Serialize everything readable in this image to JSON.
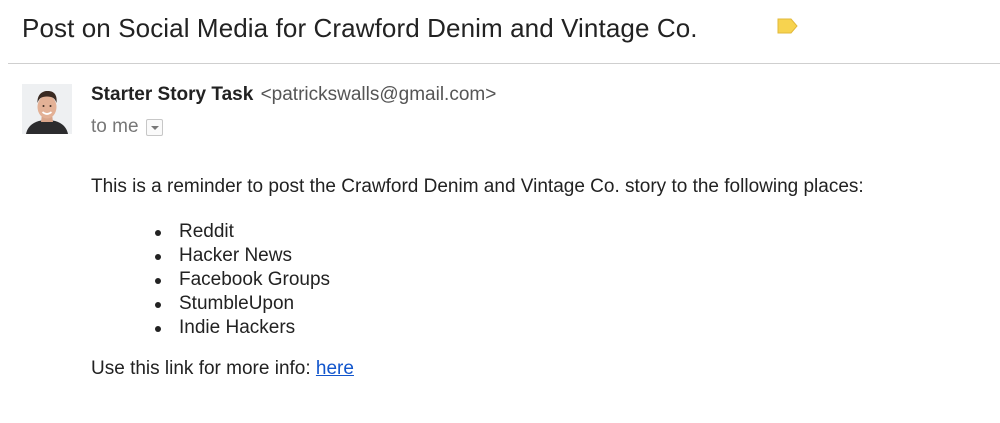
{
  "email": {
    "subject": "Post on Social Media for Crawford Denim and Vintage Co.",
    "label_color": "#f7d34f",
    "sender": {
      "name": "Starter Story Task",
      "email": "<patrickswalls@gmail.com>"
    },
    "recipient_text": "to me",
    "body": {
      "intro": "This is a reminder to post the Crawford Denim and Vintage Co. story to the following places:",
      "places": [
        "Reddit",
        "Hacker News",
        "Facebook Groups",
        "StumbleUpon",
        "Indie Hackers"
      ],
      "link_prefix": "Use this link for more info: ",
      "link_text": "here",
      "link_color": "#1155cc"
    }
  }
}
